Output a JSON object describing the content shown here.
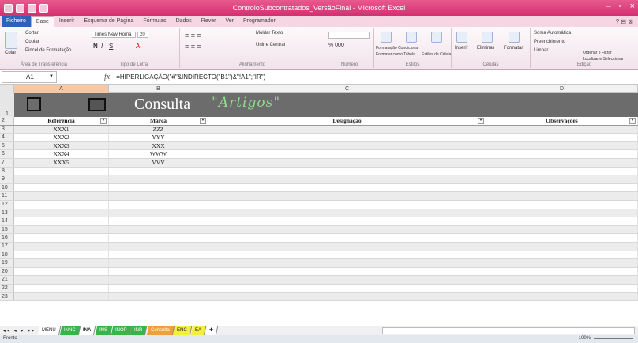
{
  "window": {
    "title": "ControloSubcontratados_VersãoFinal - Microsoft Excel"
  },
  "ribbon": {
    "tabs": [
      "Ficheiro",
      "Base",
      "Inserir",
      "Esquema de Página",
      "Fórmulas",
      "Dados",
      "Rever",
      "Ver",
      "Programador"
    ],
    "clipboard": {
      "cut": "Cortar",
      "copy": "Copiar",
      "paste": "Colar",
      "format_painter": "Pincel de Formatação",
      "label": "Área de Transferência"
    },
    "font": {
      "name": "Times New Roma",
      "size": "20",
      "label": "Tipo de Letra"
    },
    "alignment": {
      "wrap": "Moldar Texto",
      "merge": "Unir e Centrar",
      "label": "Alinhamento"
    },
    "number": {
      "label": "Número"
    },
    "styles": {
      "cond": "Formatação Condicional",
      "table": "Formatar como Tabela",
      "cell": "Estilos de Célula",
      "label": "Estilos"
    },
    "cells": {
      "insert": "Inserir",
      "delete": "Eliminar",
      "format": "Formatar",
      "label": "Células"
    },
    "editing": {
      "autosum": "Soma Automática",
      "fill": "Preenchimento",
      "clear": "Limpar",
      "sort": "Ordenar e Filtrar",
      "find": "Localizar e Seleccionar",
      "label": "Edição"
    }
  },
  "formula_bar": {
    "cell_ref": "A1",
    "formula": "=HIPERLIGAÇÃO(\"#\"&INDIRECTO(\"B1\")&\"!A1\";\"IR\")"
  },
  "columns": [
    "A",
    "B",
    "C",
    "D"
  ],
  "banner": {
    "title": "Consulta",
    "subtitle": "\"Artigos\""
  },
  "table": {
    "headers": [
      "Referência",
      "Marca",
      "Designação",
      "Observações"
    ],
    "rows": [
      [
        "XXX1",
        "ZZZ",
        "",
        ""
      ],
      [
        "XXX2",
        "YYY",
        "",
        ""
      ],
      [
        "XXX3",
        "XXX",
        "",
        ""
      ],
      [
        "XXX4",
        "WWW",
        "",
        ""
      ],
      [
        "XXX5",
        "VVV",
        "",
        ""
      ]
    ],
    "row_numbers": [
      "1",
      "2",
      "3",
      "4",
      "5",
      "6",
      "7",
      "8",
      "9",
      "10",
      "11",
      "12",
      "13",
      "14",
      "15",
      "16",
      "17",
      "18",
      "19",
      "20",
      "21",
      "22",
      "23"
    ]
  },
  "sheets": [
    {
      "name": "MENU",
      "style": "plain"
    },
    {
      "name": "INNC",
      "style": "green"
    },
    {
      "name": "INA",
      "style": "active"
    },
    {
      "name": "INS",
      "style": "green"
    },
    {
      "name": "INOP",
      "style": "green"
    },
    {
      "name": "INR",
      "style": "green"
    },
    {
      "name": "Consulta",
      "style": "orange"
    },
    {
      "name": "ENC",
      "style": "yellow"
    },
    {
      "name": "EA",
      "style": "yellow"
    }
  ],
  "status": {
    "ready": "Pronto",
    "zoom": "100%"
  }
}
